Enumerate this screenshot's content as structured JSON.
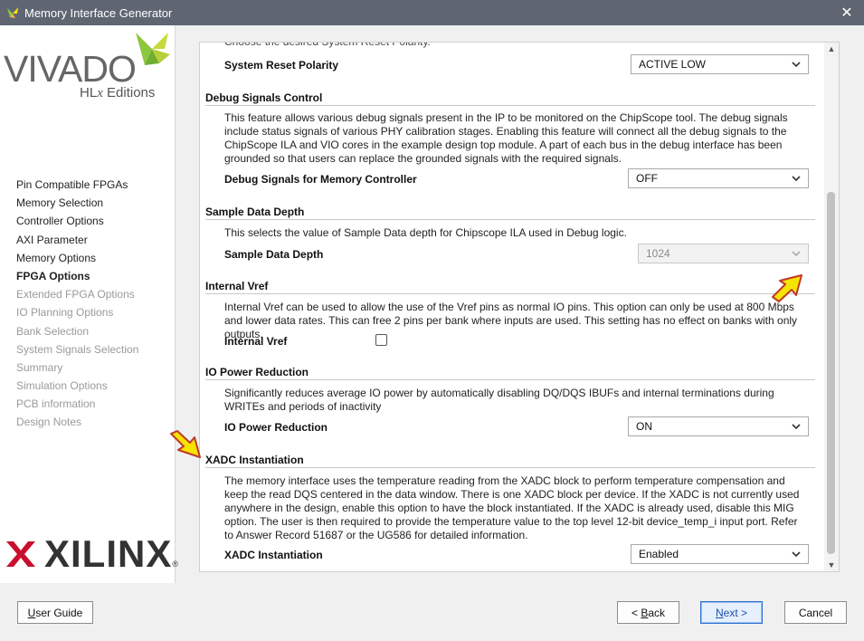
{
  "window": {
    "title": "Memory Interface Generator",
    "close_glyph": "✕"
  },
  "sidebar": {
    "logo": {
      "product": "VIVADO",
      "edition_prefix": "HL",
      "edition_italic": "x",
      "edition_suffix": " Editions"
    },
    "nav": [
      {
        "label": "Pin Compatible FPGAs",
        "state": "normal"
      },
      {
        "label": "Memory Selection",
        "state": "normal"
      },
      {
        "label": "Controller Options",
        "state": "normal"
      },
      {
        "label": "AXI Parameter",
        "state": "normal"
      },
      {
        "label": "Memory Options",
        "state": "normal"
      },
      {
        "label": "FPGA Options",
        "state": "active"
      },
      {
        "label": "Extended FPGA Options",
        "state": "disabled"
      },
      {
        "label": "IO Planning Options",
        "state": "disabled"
      },
      {
        "label": "Bank Selection",
        "state": "disabled"
      },
      {
        "label": "System Signals Selection",
        "state": "disabled"
      },
      {
        "label": "Summary",
        "state": "disabled"
      },
      {
        "label": "Simulation Options",
        "state": "disabled"
      },
      {
        "label": "PCB information",
        "state": "disabled"
      },
      {
        "label": "Design Notes",
        "state": "disabled"
      }
    ],
    "company_logo": {
      "text": "XILINX",
      "mark": "®"
    }
  },
  "main": {
    "cutoff_text": "Choose the desired System Reset Polarity.",
    "reset": {
      "label": "System Reset Polarity",
      "value": "ACTIVE LOW"
    },
    "debug": {
      "title": "Debug Signals Control",
      "description": "This feature allows various debug signals present in the IP to be monitored on the ChipScope tool. The debug signals include status signals of various PHY calibration stages. Enabling this feature will connect all the debug signals to the ChipScope ILA and VIO cores in the example design top module. A part of each bus in the debug interface has been grounded so that users can replace the grounded signals with the required signals.",
      "label": "Debug Signals for Memory Controller",
      "value": "OFF"
    },
    "sample": {
      "title": "Sample Data Depth",
      "description": "This selects the value of Sample Data depth for Chipscope ILA used in Debug logic.",
      "label": "Sample Data Depth",
      "value": "1024"
    },
    "vref": {
      "title": "Internal Vref",
      "description": "Internal Vref can be used to allow the use of the Vref pins as normal IO pins. This option can only be used at 800 Mbps and lower data rates. This can free 2 pins per bank where inputs are used. This setting has no effect on banks with only outputs.",
      "label": "Internal Vref",
      "checked": false
    },
    "power": {
      "title": "IO Power Reduction",
      "description": "Significantly reduces average IO power by automatically disabling DQ/DQS IBUFs and internal terminations during WRITEs and periods of inactivity",
      "label": "IO Power Reduction",
      "value": "ON"
    },
    "xadc": {
      "title": "XADC Instantiation",
      "description": "The memory interface uses the temperature reading from the XADC block to perform temperature compensation and keep the read DQS centered in the data window. There is one XADC block per device. If the XADC is not currently used anywhere in the design, enable this option to have the block instantiated. If the XADC is already used, disable this MIG option. The user is then required to provide the temperature value to the top level 12-bit device_temp_i input port. Refer to Answer Record 51687 or the UG586 for detailed information.",
      "label": "XADC Instantiation",
      "value": "Enabled"
    }
  },
  "footer": {
    "user_guide": {
      "accel": "U",
      "rest": "ser Guide"
    },
    "back": {
      "prefix": "< ",
      "accel": "B",
      "rest": "ack"
    },
    "next": {
      "accel": "N",
      "rest": "ext >"
    },
    "cancel": "Cancel"
  },
  "colors": {
    "titlebar": "#5f6672",
    "highlight_arrow": "#f5e400",
    "arrow_outline": "#c0392b",
    "xilinx_red": "#c8102e",
    "vivado_green": "#8dc63f"
  }
}
